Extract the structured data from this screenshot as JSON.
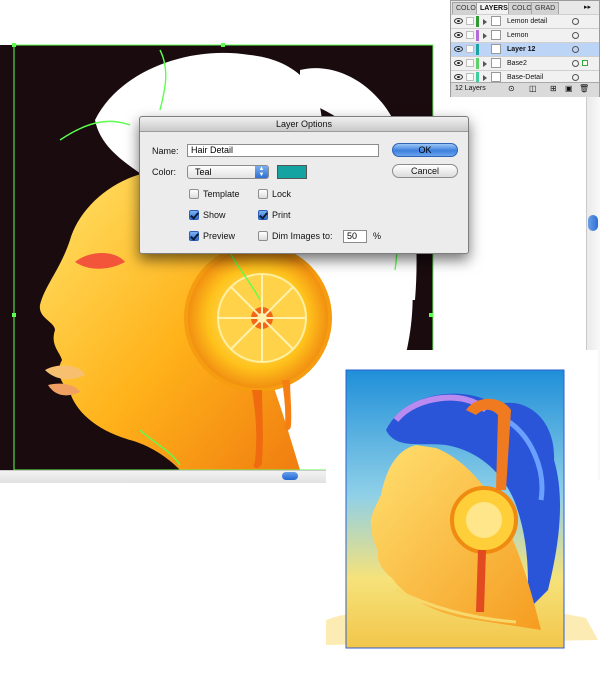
{
  "layers_panel": {
    "tabs": [
      "COLO",
      "LAYERS",
      "COLO",
      "GRAD"
    ],
    "layers": [
      {
        "name": "Lemon detail",
        "color": "#2f9a35"
      },
      {
        "name": "Lemon",
        "color": "#b36ad8"
      },
      {
        "name": "Layer 12",
        "color": "#1ea3a3"
      },
      {
        "name": "Base2",
        "color": "#5fd36a"
      },
      {
        "name": "Base-Detail",
        "color": "#3fcf9e"
      }
    ],
    "layer_count": "12 Layers",
    "selected_layer": "Layer 12"
  },
  "dialog": {
    "title": "Layer Options",
    "name_label": "Name:",
    "name_value": "Hair Detail",
    "color_label": "Color:",
    "color_value": "Teal",
    "color_swatch": "#14a3a0",
    "template_label": "Template",
    "template_checked": false,
    "lock_label": "Lock",
    "lock_checked": false,
    "show_label": "Show",
    "show_checked": true,
    "print_label": "Print",
    "print_checked": true,
    "preview_label": "Preview",
    "preview_checked": true,
    "dim_label": "Dim Images to:",
    "dim_checked": false,
    "dim_value": "50",
    "dim_unit": "%",
    "ok_label": "OK",
    "cancel_label": "Cancel"
  },
  "colors": {
    "canvas_bg": "#1a0b0f",
    "selection_green": "#5cff4e",
    "accent_blue": "#2f6fd2"
  }
}
